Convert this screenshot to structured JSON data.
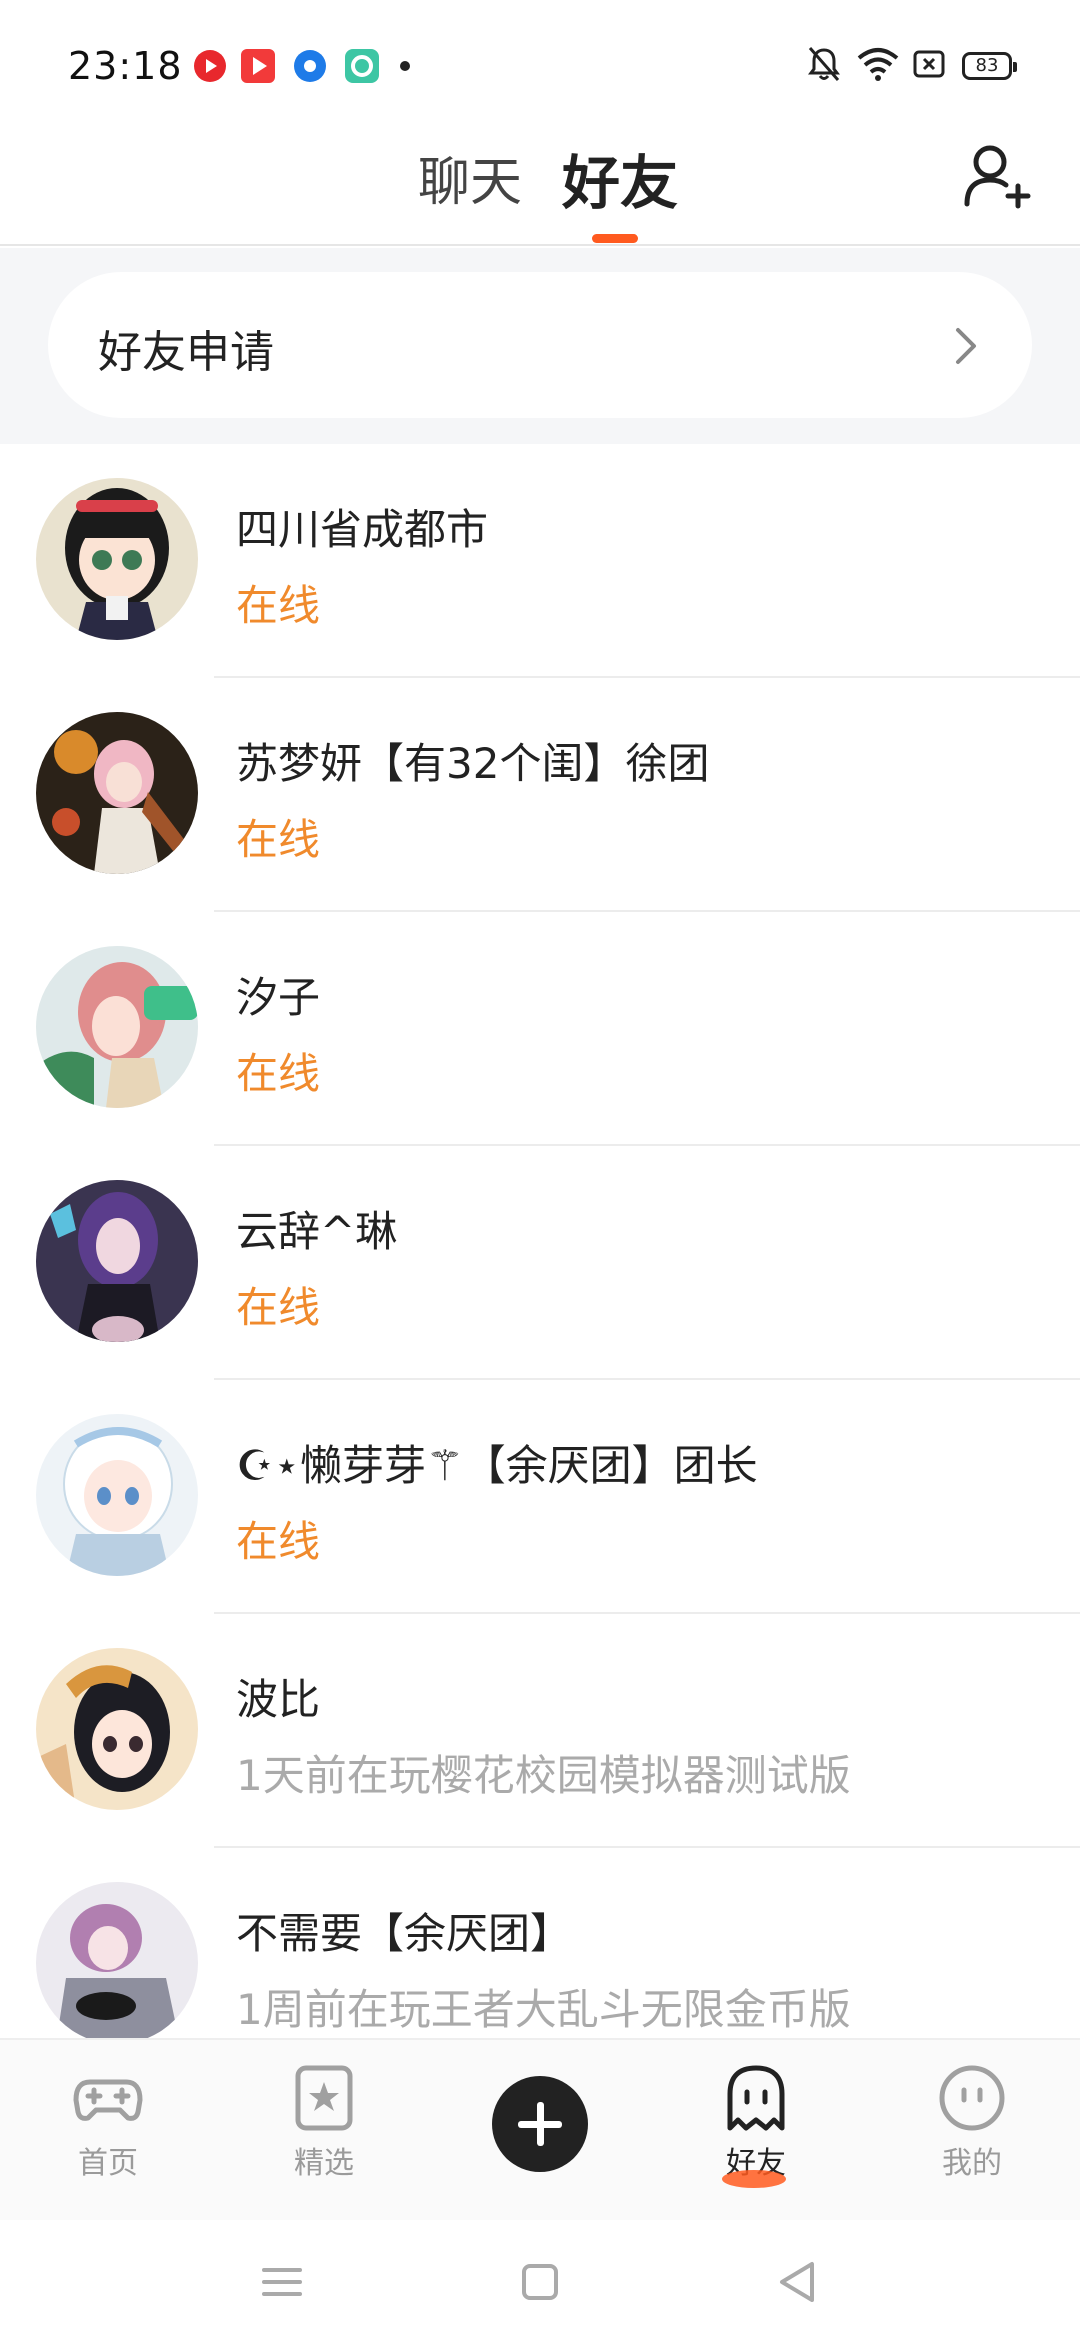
{
  "status_bar": {
    "time": "23:18",
    "battery": "83",
    "app_icons": [
      "red-app-icon",
      "video-app-icon",
      "blue-app-icon",
      "teal-app-icon"
    ],
    "system_icons": [
      "mute-bell-icon",
      "wifi-icon",
      "sim-icon",
      "battery-icon"
    ]
  },
  "header": {
    "tabs": [
      {
        "label": "聊天",
        "active": false
      },
      {
        "label": "好友",
        "active": true
      }
    ],
    "accent_color": "#ff5a1f"
  },
  "friend_request": {
    "label": "好友申请"
  },
  "friends": [
    {
      "name": "四川省成都市",
      "status": "在线",
      "online": true
    },
    {
      "name": "苏梦妍【有32个闺】徐团",
      "status": "在线",
      "online": true
    },
    {
      "name": "汐子",
      "status": "在线",
      "online": true
    },
    {
      "name": "云辞^琳",
      "status": "在线",
      "online": true
    },
    {
      "name": "☪⋆懒芽芽⚚【余厌团】团长",
      "status": "在线",
      "online": true
    },
    {
      "name": "波比",
      "status": "1天前在玩樱花校园模拟器测试版",
      "online": false
    },
    {
      "name": "不需要【余厌团】",
      "status": "1周前在玩王者大乱斗无限金币版",
      "online": false
    }
  ],
  "bottom_nav": {
    "items": [
      {
        "label": "首页",
        "icon": "gamepad-icon",
        "active": false
      },
      {
        "label": "精选",
        "icon": "star-bookmark-icon",
        "active": false
      },
      {
        "label": "",
        "icon": "plus-icon",
        "active": false
      },
      {
        "label": "好友",
        "icon": "ghost-icon",
        "active": true
      },
      {
        "label": "我的",
        "icon": "face-icon",
        "active": false
      }
    ]
  },
  "colors": {
    "online": "#f08a2c",
    "offline": "#aaaaaa"
  }
}
